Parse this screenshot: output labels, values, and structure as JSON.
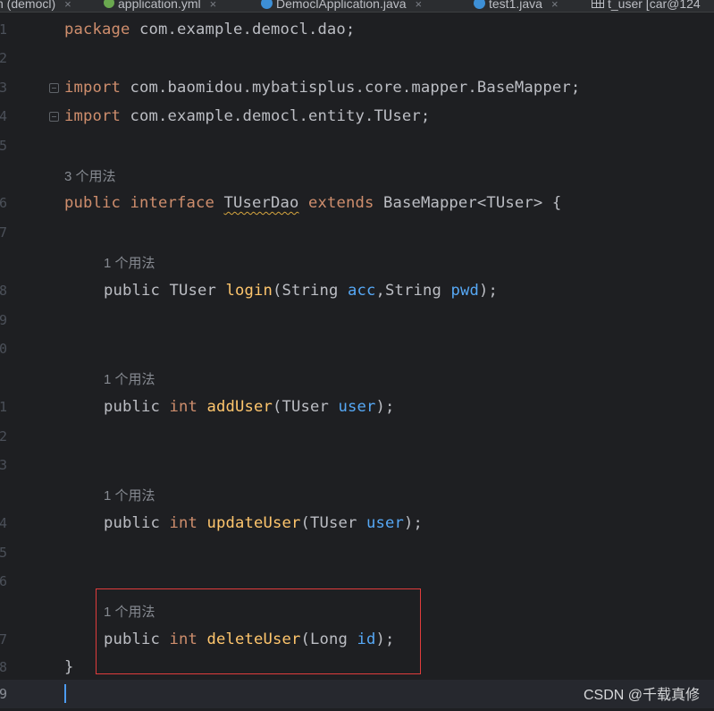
{
  "tabs": [
    {
      "label": "n (democl)",
      "icon": "none"
    },
    {
      "label": "application.yml",
      "icon": "yml-file-icon"
    },
    {
      "label": "DemoclApplication.java",
      "icon": "java-class-icon"
    },
    {
      "label": "test1.java",
      "icon": "java-class-icon"
    },
    {
      "label": "t_user [car@124",
      "icon": "table-icon"
    }
  ],
  "close_glyph": "×",
  "lines": [
    {
      "number": "1",
      "code": "package com.example.democl.dao;"
    },
    {
      "number": "2",
      "code": ""
    },
    {
      "number": "3",
      "code": "import com.baomidou.mybatisplus.core.mapper.BaseMapper;"
    },
    {
      "number": "4",
      "code": "import com.example.democl.entity.TUser;"
    },
    {
      "number": "5",
      "code": ""
    },
    {
      "hint": "3 个用法"
    },
    {
      "number": "6",
      "code": "public interface TUserDao extends BaseMapper<TUser> {"
    },
    {
      "number": "7",
      "code": ""
    },
    {
      "hint": "1 个用法"
    },
    {
      "number": "8",
      "code": "public TUser login(String acc,String pwd);"
    },
    {
      "number": "9",
      "code": ""
    },
    {
      "number": "0",
      "code": ""
    },
    {
      "hint": "1 个用法"
    },
    {
      "number": "1",
      "code": "public int addUser(TUser user);"
    },
    {
      "number": "2",
      "code": ""
    },
    {
      "number": "3",
      "code": ""
    },
    {
      "hint": "1 个用法"
    },
    {
      "number": "4",
      "code": "public int updateUser(TUser user);"
    },
    {
      "number": "5",
      "code": ""
    },
    {
      "number": "6",
      "code": ""
    },
    {
      "hint": "1 个用法"
    },
    {
      "number": "7",
      "code": "public int deleteUser(Long id);"
    },
    {
      "number": "8",
      "code": "}"
    },
    {
      "number": "9",
      "code": ""
    }
  ],
  "code_tokens": {
    "pkg_kw": "package",
    "pkg_name": " com.example.democl.dao;",
    "import_kw": "import",
    "import1": " com.baomidou.mybatisplus.core.mapper.BaseMapper;",
    "import2": " com.example.democl.entity.TUser;",
    "public_kw": "public",
    "interface_kw": "interface",
    "iface_name": "TUserDao",
    "extends_kw": "extends",
    "base_type": "BaseMapper<TUser> {",
    "int_kw": "int",
    "ret_tuser": "TUser",
    "login_fn": "login",
    "login_args_a": "(String ",
    "login_acc": "acc",
    "login_args_b": ",String ",
    "login_pwd": "pwd",
    "login_end": ");",
    "add_fn": "addUser",
    "update_fn": "updateUser",
    "delete_fn": "deleteUser",
    "tuser_open": "(TUser ",
    "user_param": "user",
    "long_open": "(Long ",
    "id_param": "id",
    "close_paren": ");",
    "close_brace": "}"
  },
  "watermark": "CSDN @千载真修",
  "colors": {
    "keyword": "#cf8e6d",
    "method": "#ffc66d",
    "param": "#56a8f5",
    "plain": "#bcbec4",
    "highlight_border": "#e03c3c"
  }
}
